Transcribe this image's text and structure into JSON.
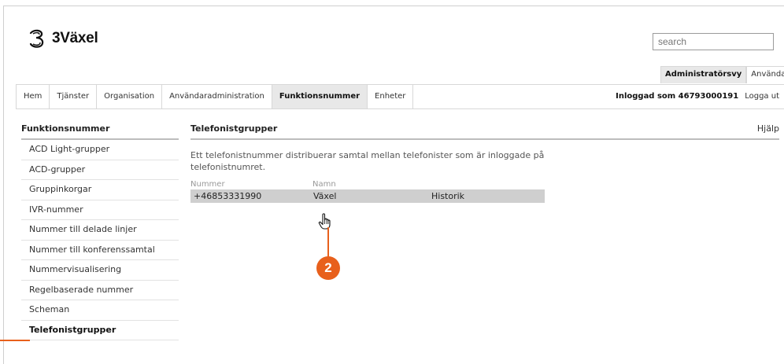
{
  "brand": {
    "name": "3Växel",
    "logo_icon": "three-logo-icon"
  },
  "search": {
    "placeholder": "search"
  },
  "views": [
    {
      "label": "Administratörsvy",
      "active": true
    },
    {
      "label": "Användarvy",
      "active": false
    }
  ],
  "nav": {
    "items": [
      {
        "label": "Hem"
      },
      {
        "label": "Tjänster"
      },
      {
        "label": "Organisation"
      },
      {
        "label": "Användaradministration"
      },
      {
        "label": "Funktionsnummer",
        "active": true
      },
      {
        "label": "Enheter"
      }
    ],
    "logged_in": "Inloggad som 46793000191",
    "logout": "Logga ut"
  },
  "sidebar": {
    "title": "Funktionsnummer",
    "items": [
      {
        "label": "ACD Light-grupper"
      },
      {
        "label": "ACD-grupper"
      },
      {
        "label": "Gruppinkorgar"
      },
      {
        "label": "IVR-nummer"
      },
      {
        "label": "Nummer till delade linjer"
      },
      {
        "label": "Nummer till konferenssamtal"
      },
      {
        "label": "Nummervisualisering"
      },
      {
        "label": "Regelbaserade nummer"
      },
      {
        "label": "Scheman"
      },
      {
        "label": "Telefonistgrupper",
        "active": true
      }
    ]
  },
  "main": {
    "title": "Telefonistgrupper",
    "help": "Hjälp",
    "description": "Ett telefonistnummer distribuerar samtal mellan telefonister som är inloggade på telefonistnumret.",
    "table": {
      "headers": [
        "Nummer",
        "Namn"
      ],
      "rows": [
        {
          "number": "+46853331990",
          "name": "Växel",
          "history": "Historik"
        }
      ]
    }
  },
  "callout": {
    "number": "2",
    "color": "#e8601c"
  },
  "cursor_icon": "hand-pointer-icon"
}
